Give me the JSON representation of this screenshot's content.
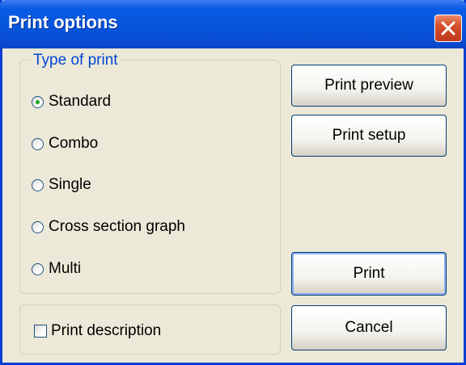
{
  "window": {
    "title": "Print options"
  },
  "type_of_print": {
    "legend": "Type of print",
    "options": [
      {
        "label": "Standard",
        "checked": true
      },
      {
        "label": "Combo",
        "checked": false
      },
      {
        "label": "Single",
        "checked": false
      },
      {
        "label": "Cross section graph",
        "checked": false
      },
      {
        "label": "Multi",
        "checked": false
      }
    ]
  },
  "print_description": {
    "label": "Print description",
    "checked": false
  },
  "buttons": {
    "print_preview": "Print preview",
    "print_setup": "Print setup",
    "print": "Print",
    "cancel": "Cancel"
  },
  "colors": {
    "title_bar": "#0a5be3",
    "close_button": "#d5502c",
    "dialog_background": "#ece9d8",
    "group_legend": "#0046d5",
    "radio_selected_dot": "#21a121"
  }
}
